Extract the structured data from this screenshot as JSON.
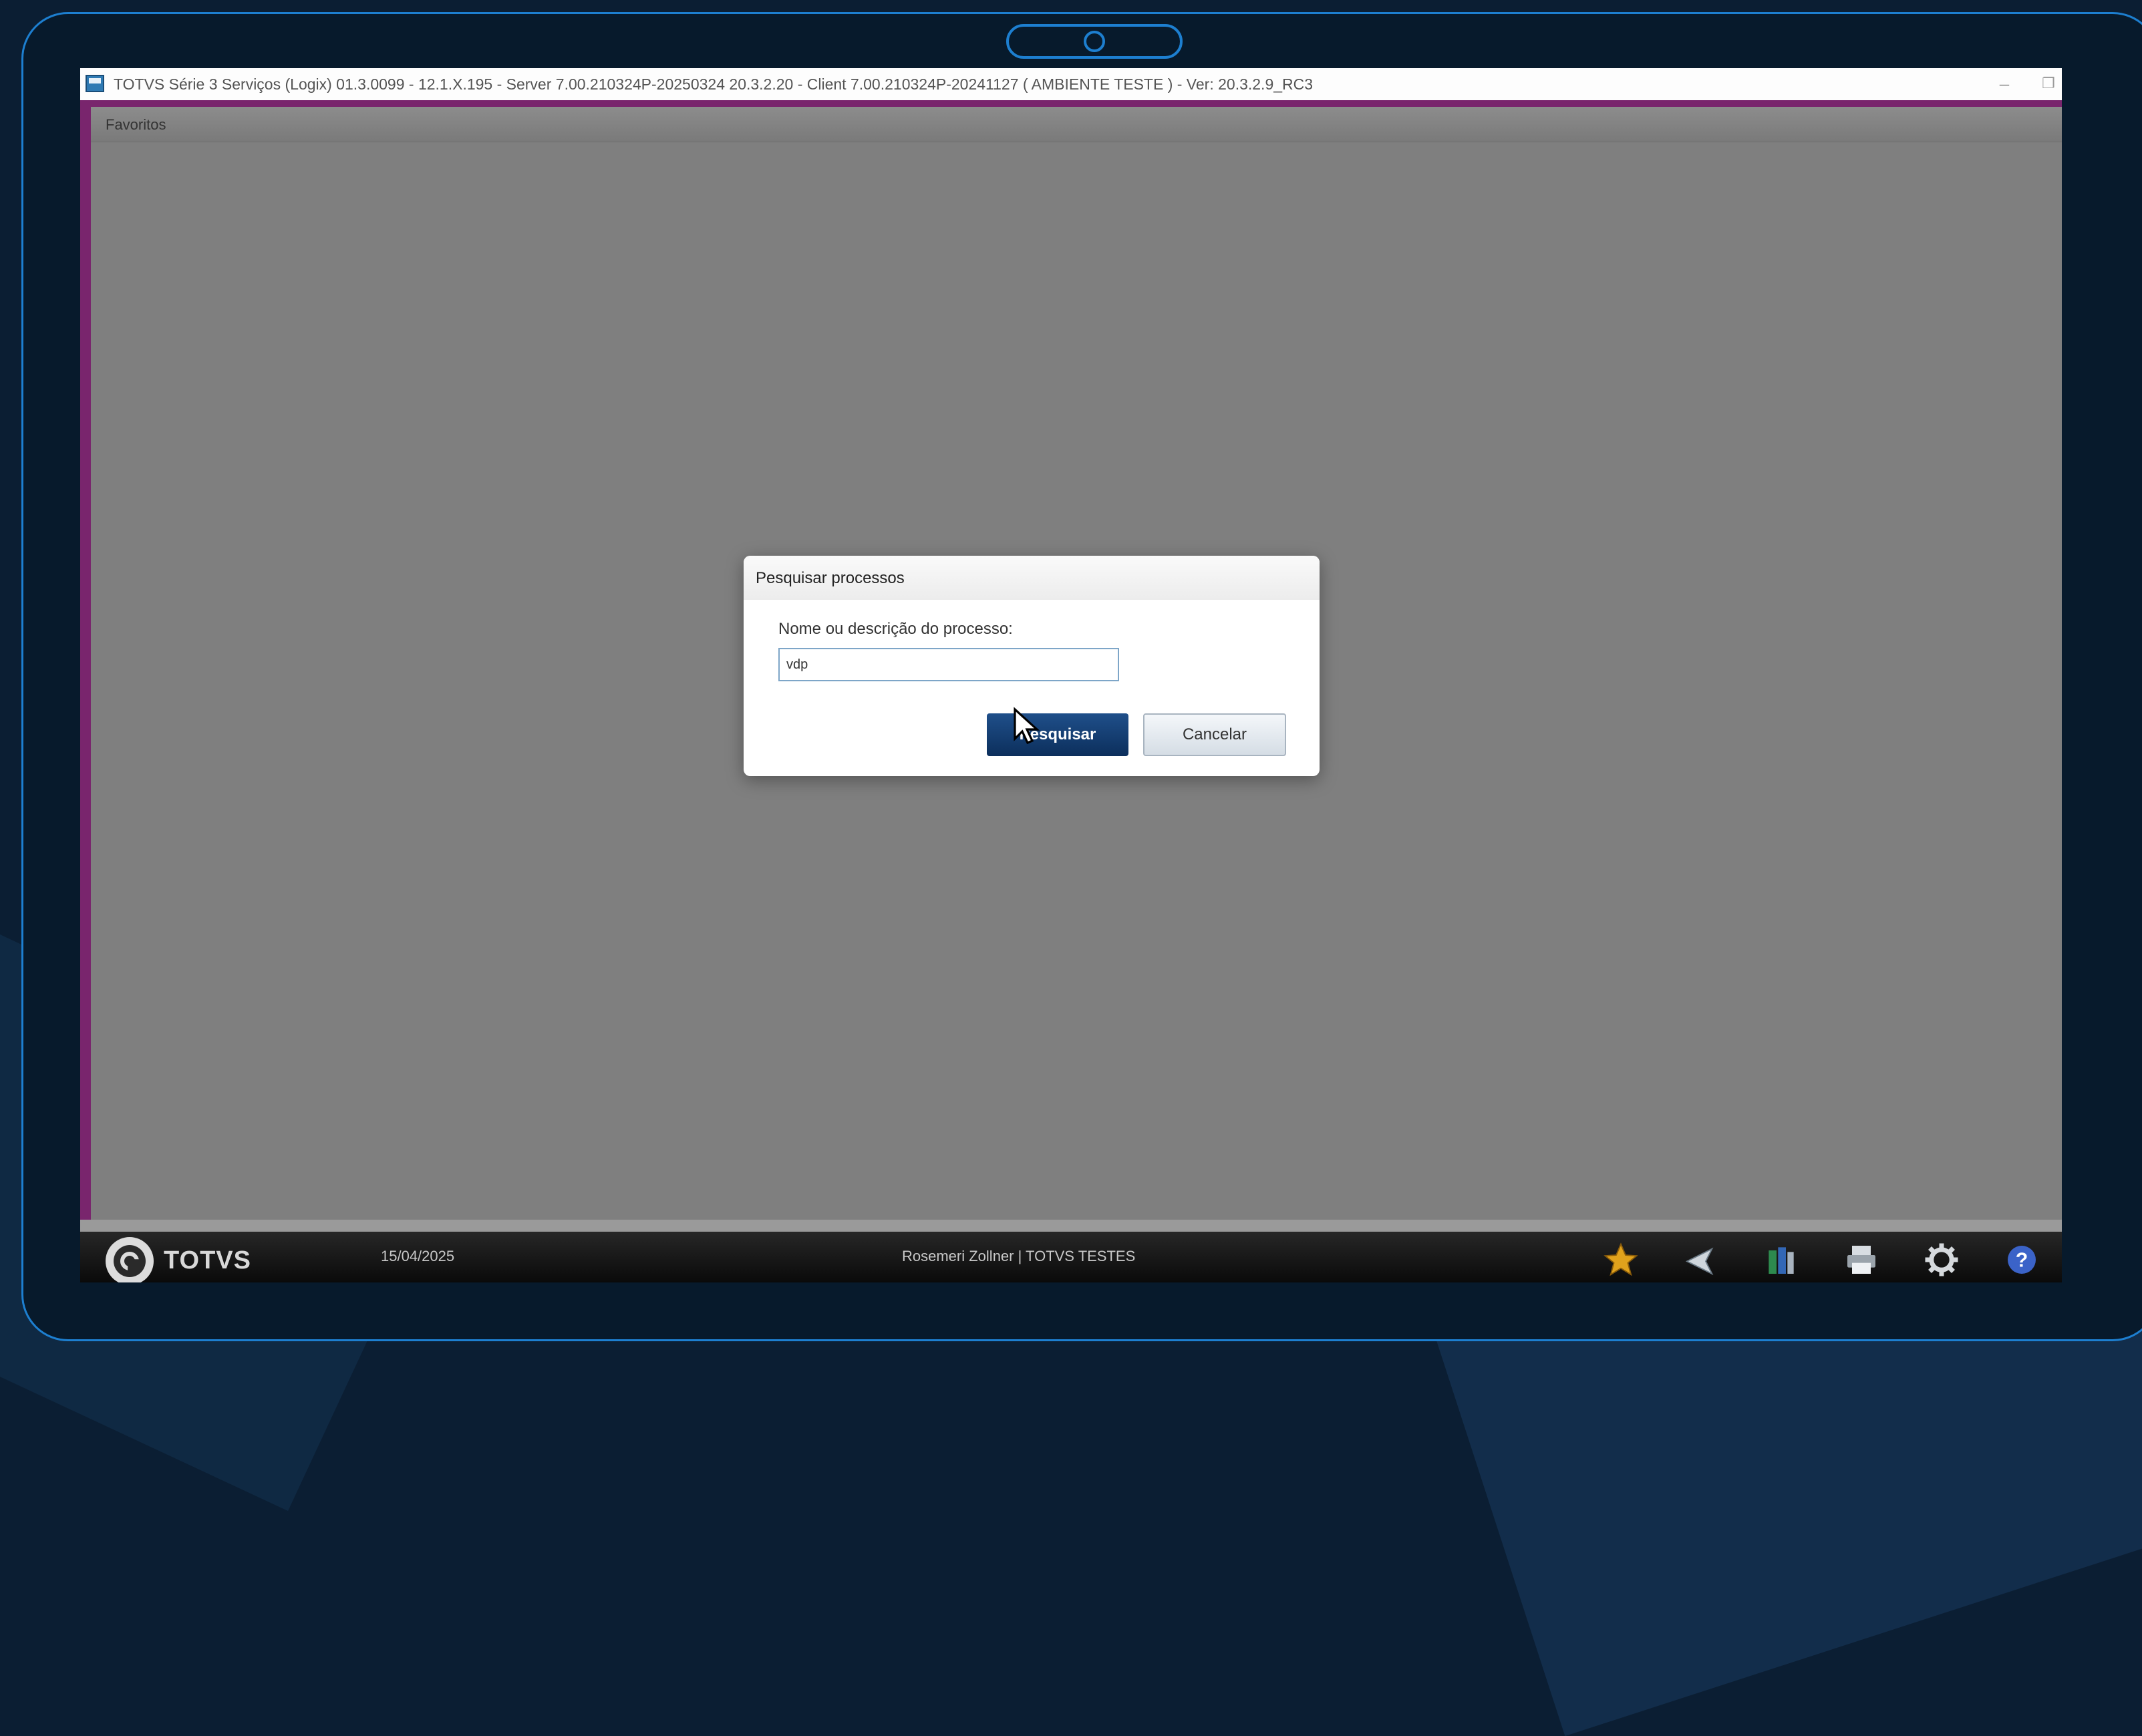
{
  "window": {
    "title": "TOTVS Série 3 Serviços (Logix) 01.3.0099  -  12.1.X.195 - Server 7.00.210324P-20250324 20.3.2.20 - Client 7.00.210324P-20241127    ( AMBIENTE TESTE )  - Ver: 20.3.2.9_RC3",
    "minimize_glyph": "–",
    "restore_glyph": "❐",
    "close_glyph": "✕"
  },
  "favorites": {
    "label": "Favoritos"
  },
  "dialog": {
    "title": "Pesquisar processos",
    "field_label": "Nome ou descrição do processo:",
    "field_value": "vdp",
    "search_button": "Pesquisar",
    "cancel_button": "Cancelar"
  },
  "statusbar": {
    "logo_text": "TOTVS",
    "date": "15/04/2025",
    "user": "Rosemeri Zollner | TOTVS TESTES",
    "tray_icons": [
      "star-icon",
      "back-arrow-icon",
      "books-icon",
      "printer-icon",
      "gear-icon",
      "help-icon",
      "lock-icon"
    ]
  },
  "colors": {
    "accent": "#79256d",
    "primary_button": "#0c2f5c",
    "frame_border": "#1d7fd0",
    "star": "#e0a21c",
    "help": "#3b63c8"
  }
}
